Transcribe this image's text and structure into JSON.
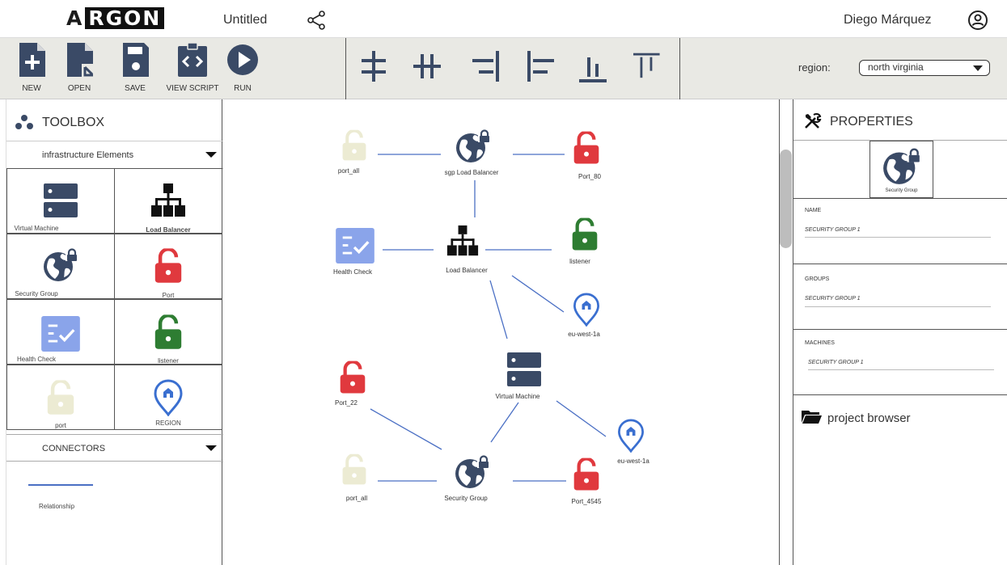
{
  "header": {
    "logo_first": "A",
    "logo_rest": "RGON",
    "doc_title": "Untitled",
    "user_name": "Diego Márquez"
  },
  "toolbar": {
    "new_label": "NEW",
    "open_label": "OPEN",
    "save_label": "SAVE",
    "view_script_label": "VIEW SCRIPT",
    "run_label": "RUN",
    "region_label": "region:",
    "region_value": "north virginia"
  },
  "toolbox": {
    "title": "TOOLBOX",
    "infra_section": "infrastructure Elements",
    "connectors_section": "CONNECTORS",
    "items": [
      {
        "label": "Virtual Machine"
      },
      {
        "label": "Load Balancer"
      },
      {
        "label": "Security Group"
      },
      {
        "label": "Port"
      },
      {
        "label": "Health Check"
      },
      {
        "label": "listener"
      },
      {
        "label": "port"
      },
      {
        "label": "REGION"
      }
    ],
    "connector_label": "Relationship"
  },
  "canvas": {
    "nodes": [
      {
        "label": "port_all"
      },
      {
        "label": "sgp Load Balancer"
      },
      {
        "label": "Port_80"
      },
      {
        "label": "Health Check"
      },
      {
        "label": "Load Balancer"
      },
      {
        "label": "listener"
      },
      {
        "label": "eu-west-1a"
      },
      {
        "label": "Port_22"
      },
      {
        "label": "Virtual Machine"
      },
      {
        "label": "eu-west-1a"
      },
      {
        "label": "port_all"
      },
      {
        "label": "Security Group"
      },
      {
        "label": "Port_4545"
      }
    ]
  },
  "properties": {
    "title": "PROPERTIES",
    "preview_label": "Security Group",
    "fields": [
      {
        "label": "NAME",
        "value": "SECURITY GROUP 1"
      },
      {
        "label": "GROUPS",
        "value": "SECURITY GROUP 1"
      },
      {
        "label": "MACHINES",
        "value": "SECURITY GROUP 1"
      }
    ]
  },
  "project_browser": {
    "title": "project browser"
  },
  "colors": {
    "navy": "#3a4a66",
    "red": "#e0393e",
    "green": "#2e7d32",
    "beige": "#ecebd3",
    "blue_check": "#8aa4ea",
    "link": "#4a6fc4"
  },
  "icons": {
    "vm": "server-icon",
    "lb": "hierarchy-icon",
    "sg": "globe-lock-icon",
    "port": "padlock-icon",
    "health": "checklist-icon",
    "region": "map-pin-icon"
  }
}
